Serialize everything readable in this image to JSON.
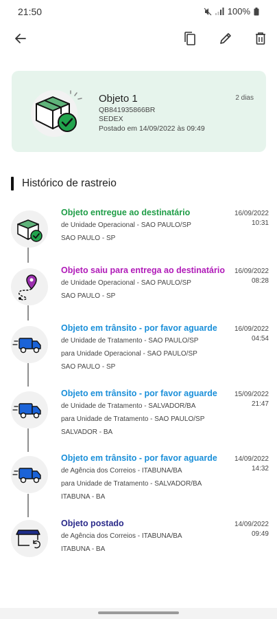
{
  "status": {
    "time": "21:50",
    "battery": "100%"
  },
  "toolbar": {
    "back_icon": "arrow-left-icon",
    "copy_icon": "copy-icon",
    "edit_icon": "pencil-icon",
    "delete_icon": "trash-icon"
  },
  "card": {
    "title": "Objeto 1",
    "code": "QB841935866BR",
    "service": "SEDEX",
    "posted": "Postado em 14/09/2022 às 09:49",
    "days": "2 dias"
  },
  "history": {
    "title": "Histórico de rastreio",
    "events": [
      {
        "title": "Objeto entregue ao destinatário",
        "color": "#1f9d47",
        "icon": "box-delivered-icon",
        "lines": [
          "de Unidade Operacional - SAO PAULO/SP",
          "SAO PAULO - SP"
        ],
        "date": "16/09/2022",
        "time": "10:31"
      },
      {
        "title": "Objeto saiu para entrega ao destinatário",
        "color": "#b01ab8",
        "icon": "location-route-icon",
        "lines": [
          "de Unidade Operacional - SAO PAULO/SP",
          "SAO PAULO - SP"
        ],
        "date": "16/09/2022",
        "time": "08:28"
      },
      {
        "title": "Objeto em trânsito - por favor aguarde",
        "color": "#1a8fd9",
        "icon": "delivery-truck-icon",
        "lines": [
          "de Unidade de Tratamento - SAO PAULO/SP",
          "para Unidade Operacional - SAO PAULO/SP",
          "SAO PAULO - SP"
        ],
        "date": "16/09/2022",
        "time": "04:54"
      },
      {
        "title": "Objeto em trânsito - por favor aguarde",
        "color": "#1a8fd9",
        "icon": "delivery-truck-icon",
        "lines": [
          "de Unidade de Tratamento - SALVADOR/BA",
          "para Unidade de Tratamento - SAO PAULO/SP",
          "SALVADOR - BA"
        ],
        "date": "15/09/2022",
        "time": "21:47"
      },
      {
        "title": "Objeto em trânsito - por favor aguarde",
        "color": "#1a8fd9",
        "icon": "delivery-truck-icon",
        "lines": [
          "de Agência dos Correios - ITABUNA/BA",
          "para Unidade de Tratamento - SALVADOR/BA",
          "ITABUNA - BA"
        ],
        "date": "14/09/2022",
        "time": "14:32"
      },
      {
        "title": "Objeto postado",
        "color": "#2a2a8a",
        "icon": "post-office-icon",
        "lines": [
          "de Agência dos Correios - ITABUNA/BA",
          "ITABUNA - BA"
        ],
        "date": "14/09/2022",
        "time": "09:49"
      }
    ]
  }
}
